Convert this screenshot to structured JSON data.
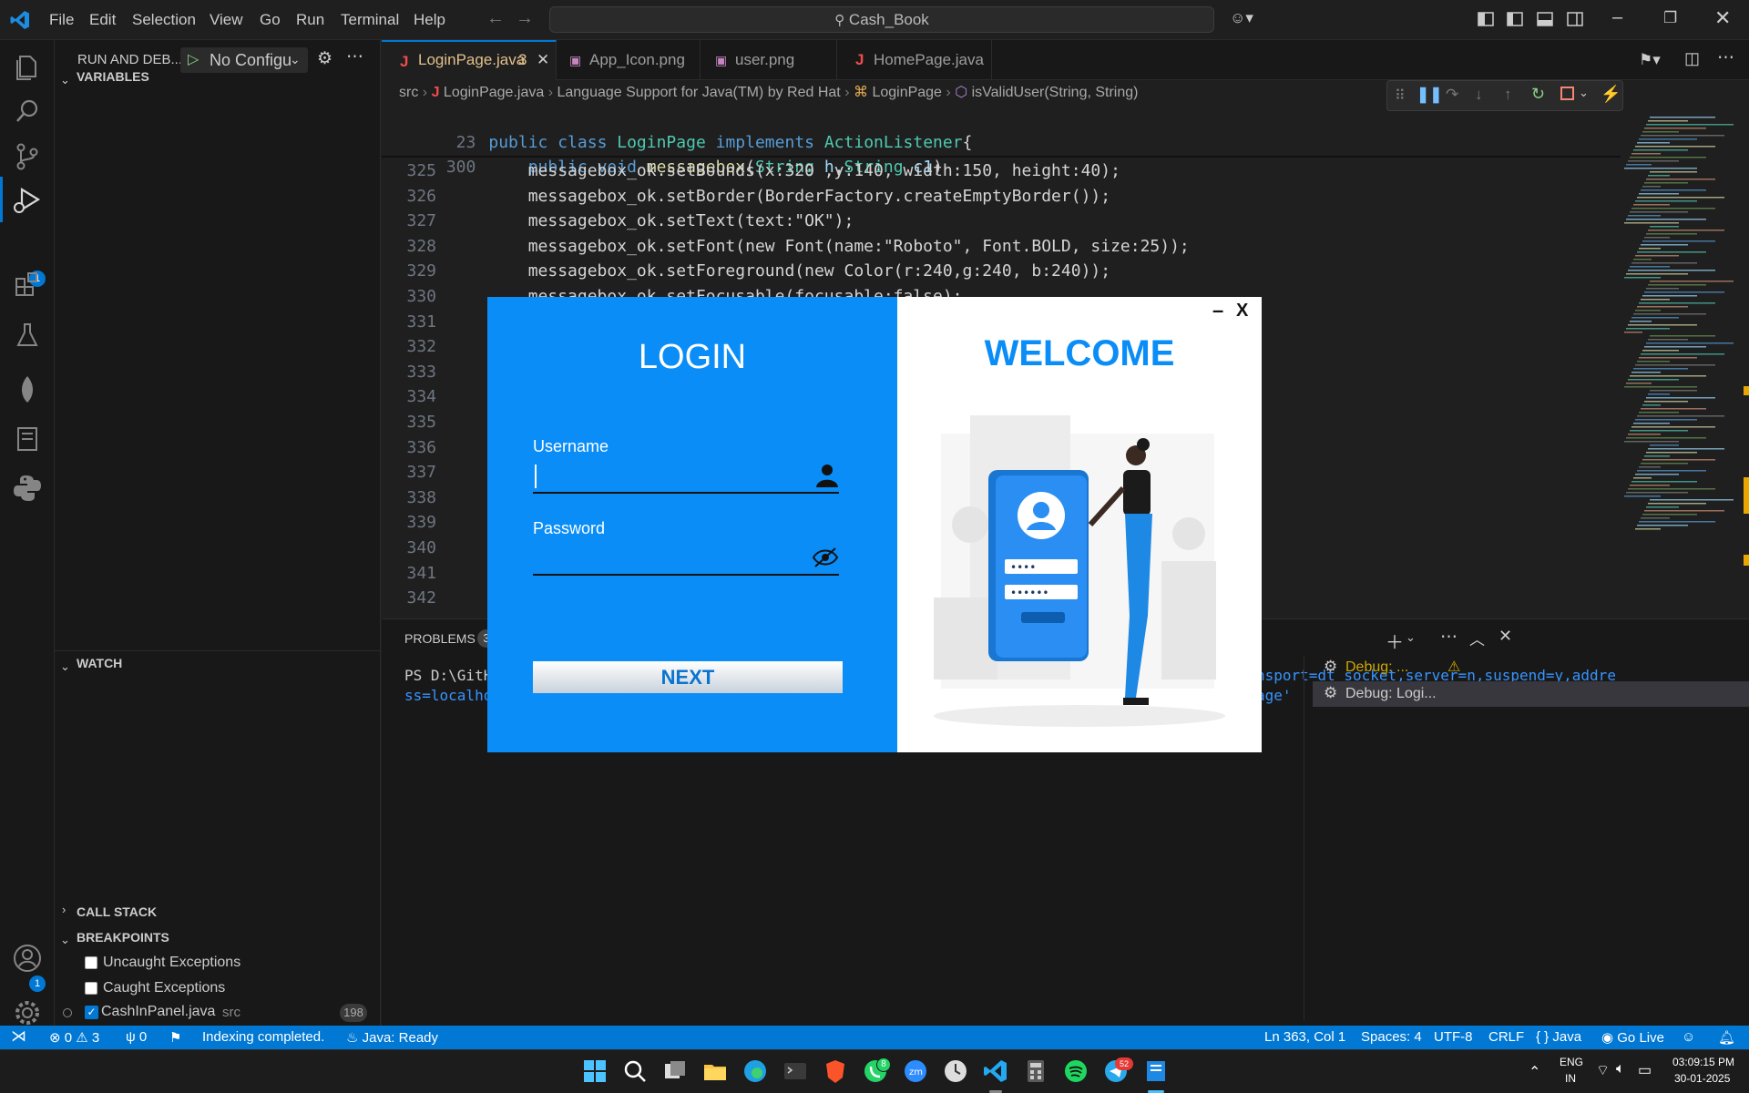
{
  "menu": [
    "File",
    "Edit",
    "Selection",
    "View",
    "Go",
    "Run",
    "Terminal",
    "Help"
  ],
  "search": {
    "text": "Cash_Book"
  },
  "activity": {
    "debug_badge": "1",
    "account_badge": "1"
  },
  "sidebar": {
    "title": "RUN AND DEB...",
    "config": "No Configu",
    "variables": "VARIABLES",
    "watch": "WATCH",
    "call_stack": "CALL STACK",
    "breakpoints": "BREAKPOINTS",
    "bp_items": [
      {
        "label": "Uncaught Exceptions",
        "checked": false
      },
      {
        "label": "Caught Exceptions",
        "checked": false
      },
      {
        "label": "CashInPanel.java",
        "path": "src",
        "count": "198",
        "checked": true
      }
    ]
  },
  "tabs": [
    {
      "name": "LoginPage.java",
      "badge": "3",
      "active": true
    },
    {
      "name": "App_Icon.png"
    },
    {
      "name": "user.png"
    },
    {
      "name": "HomePage.java"
    }
  ],
  "breadcrumb": [
    "src",
    "LoginPage.java",
    "Language Support for Java(TM) by Red Hat",
    "LoginPage",
    "isValidUser(String, String)"
  ],
  "code": {
    "sticky": [
      {
        "n": "23",
        "text": "public class LoginPage implements ActionListener{"
      },
      {
        "n": "300",
        "text": "    public void messagebox(String h,String c1)"
      }
    ],
    "lines": [
      {
        "n": "325",
        "text": "        messagebox_ok.setBounds(x:320 ,y:140, width:150, height:40);"
      },
      {
        "n": "326",
        "text": "        messagebox_ok.setBorder(BorderFactory.createEmptyBorder());"
      },
      {
        "n": "327",
        "text": "        messagebox_ok.setText(text:\"OK\");"
      },
      {
        "n": "328",
        "text": "        messagebox_ok.setFont(new Font(name:\"Roboto\", Font.BOLD, size:25));"
      },
      {
        "n": "329",
        "text": "        messagebox_ok.setForeground(new Color(r:240,g:240, b:240));"
      },
      {
        "n": "330",
        "text": "        messagebox_ok.setFocusable(focusable:false);"
      },
      {
        "n": "331",
        "text": ""
      },
      {
        "n": "332",
        "text": ""
      },
      {
        "n": "333",
        "text": ""
      },
      {
        "n": "334",
        "text": ""
      },
      {
        "n": "335",
        "text": ""
      },
      {
        "n": "336",
        "text": ""
      },
      {
        "n": "337",
        "text": ""
      },
      {
        "n": "338",
        "text": ""
      },
      {
        "n": "339",
        "text": ""
      },
      {
        "n": "340",
        "text": ""
      },
      {
        "n": "341",
        "text": ""
      },
      {
        "n": "342",
        "text": ""
      }
    ]
  },
  "panel": {
    "tab": "PROBLEMS",
    "tab_badge": "3",
    "term_line1_left": "PS D:\\GitH",
    "term_line1_right": "nsport=dt_socket,server=n,suspend=y,addre",
    "term_line2_left": "ss=localho",
    "term_line2_right": "age'",
    "sessions": [
      "Debug: ...",
      "Debug: Logi..."
    ]
  },
  "login": {
    "left_title": "LOGIN",
    "username_label": "Username",
    "password_label": "Password",
    "next": "NEXT",
    "right_title": "WELCOME",
    "minimize": "–",
    "close": "X",
    "pin_stars": "••••",
    "pass_stars": "••••••"
  },
  "status": {
    "errors": "0",
    "warnings": "3",
    "ports": "0",
    "indexing": "Indexing completed.",
    "java": "Java: Ready",
    "position": "Ln 363, Col 1",
    "spaces": "Spaces: 4",
    "encoding": "UTF-8",
    "eol": "CRLF",
    "lang": "Java",
    "golive": "Go Live"
  },
  "taskbar": {
    "whatsapp_badge": "8",
    "telegram_badge": "52",
    "lang": "ENG",
    "region": "IN",
    "time": "03:09:15 PM",
    "date": "30-01-2025"
  },
  "colors": {
    "accent": "#0078d4",
    "login_blue": "#0a8df7"
  }
}
